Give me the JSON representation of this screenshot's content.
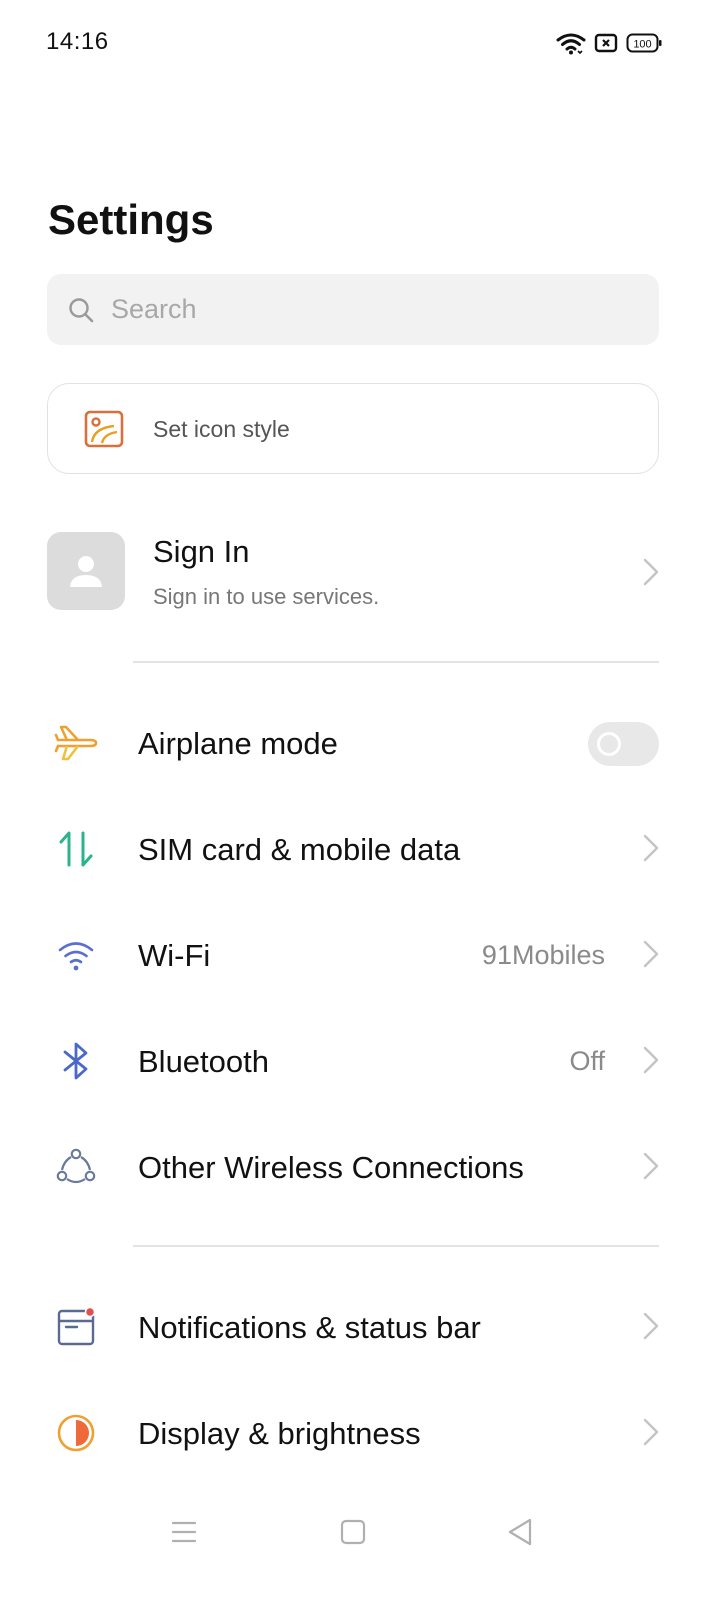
{
  "status_bar": {
    "time": "14:16",
    "battery": "100"
  },
  "header": {
    "title": "Settings"
  },
  "search": {
    "placeholder": "Search"
  },
  "icon_style_card": {
    "label": "Set icon style",
    "icon": "image-style-icon",
    "color": "#d9703c"
  },
  "account": {
    "title": "Sign In",
    "subtitle": "Sign in to use services."
  },
  "connectivity": [
    {
      "label": "Airplane mode",
      "icon": "airplane-icon",
      "toggle": false
    },
    {
      "label": "SIM card & mobile data",
      "icon": "sim-data-icon"
    },
    {
      "label": "Wi-Fi",
      "icon": "wifi-icon",
      "value": "91Mobiles"
    },
    {
      "label": "Bluetooth",
      "icon": "bluetooth-icon",
      "value": "Off"
    },
    {
      "label": "Other Wireless Connections",
      "icon": "wireless-connections-icon"
    }
  ],
  "system": [
    {
      "label": "Notifications & status bar",
      "icon": "notifications-icon"
    },
    {
      "label": "Display & brightness",
      "icon": "display-brightness-icon"
    }
  ],
  "nav_bar": {
    "buttons": [
      "menu-icon",
      "home-icon",
      "back-icon"
    ]
  }
}
